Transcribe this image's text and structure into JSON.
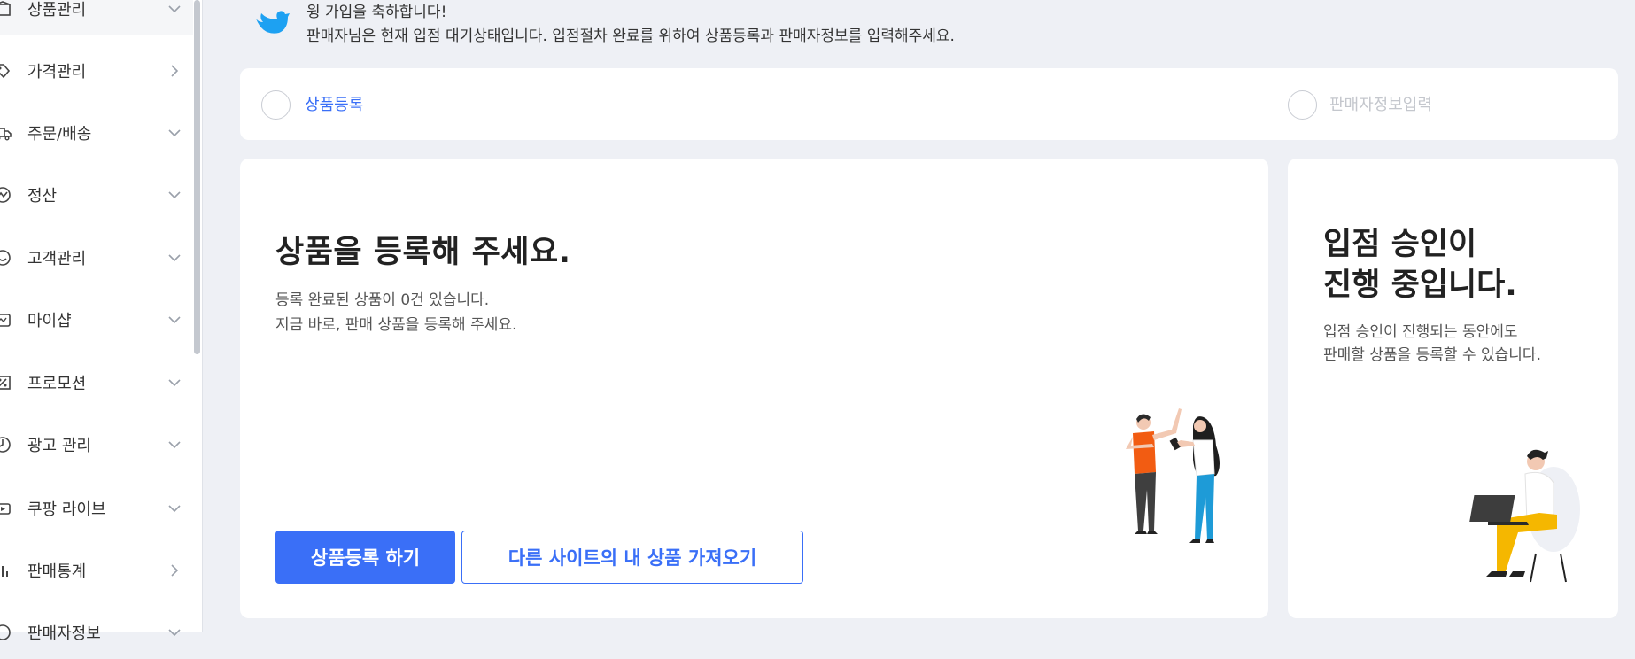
{
  "sidebar": {
    "items": [
      {
        "label": "상품관리",
        "icon": "box-icon",
        "chevron": "down"
      },
      {
        "label": "가격관리",
        "icon": "price-tag-icon",
        "chevron": "right"
      },
      {
        "label": "주문/배송",
        "icon": "truck-icon",
        "chevron": "down"
      },
      {
        "label": "정산",
        "icon": "settlement-icon",
        "chevron": "down"
      },
      {
        "label": "고객관리",
        "icon": "smile-icon",
        "chevron": "down"
      },
      {
        "label": "마이샵",
        "icon": "shop-icon",
        "chevron": "down"
      },
      {
        "label": "프로모션",
        "icon": "promotion-icon",
        "chevron": "down"
      },
      {
        "label": "광고 관리",
        "icon": "ad-icon",
        "chevron": "down"
      },
      {
        "label": "쿠팡 라이브",
        "icon": "live-icon",
        "chevron": "down"
      },
      {
        "label": "판매통계",
        "icon": "bar-chart-icon",
        "chevron": "right"
      },
      {
        "label": "판매자정보",
        "icon": "seller-info-icon",
        "chevron": "down"
      }
    ]
  },
  "welcome": {
    "line1": "윙 가입을 축하합니다!",
    "line2": "판매자님은 현재 입점 대기상태입니다. 입점절차 완료를 위하여 상품등록과 판매자정보를 입력해주세요."
  },
  "steps": [
    {
      "label": "상품등록",
      "color": "#3a6ff7"
    },
    {
      "label": "판매자정보입력",
      "color": "#c4c7cd"
    }
  ],
  "main": {
    "title": "상품을 등록해 주세요.",
    "desc_line1": "등록 완료된 상품이 0건 있습니다.",
    "desc_line2": "지금 바로, 판매 상품을 등록해 주세요.",
    "primary_button": "상품등록 하기",
    "secondary_button": "다른 사이트의 내 상품 가져오기"
  },
  "side_card": {
    "title_line1": "입점 승인이",
    "title_line2": "진행 중입니다.",
    "desc_line1": "입점 승인이 진행되는 동안에도",
    "desc_line2": "판매할 상품을 등록할 수 있습니다."
  },
  "colors": {
    "accent": "#3a6ff7",
    "background": "#eef0f5"
  }
}
